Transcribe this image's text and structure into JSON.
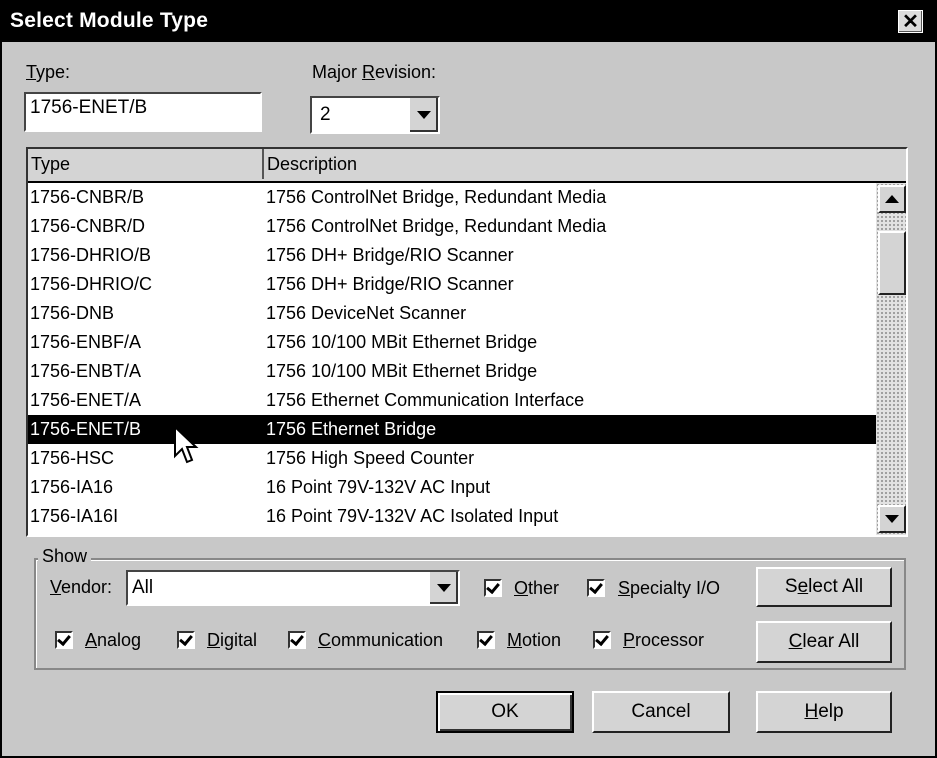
{
  "dialog": {
    "title": "Select Module Type"
  },
  "type_field": {
    "label_prefix": "",
    "label_key": "T",
    "label_rest": "ype:",
    "value": "1756-ENET/B"
  },
  "revision_field": {
    "label_prefix": "Major ",
    "label_key": "R",
    "label_rest": "evision:",
    "value": "2"
  },
  "table": {
    "columns": [
      "Type",
      "Description"
    ],
    "rows": [
      {
        "type": "1756-CNBR/B",
        "description": "1756 ControlNet Bridge, Redundant Media"
      },
      {
        "type": "1756-CNBR/D",
        "description": "1756 ControlNet Bridge, Redundant Media"
      },
      {
        "type": "1756-DHRIO/B",
        "description": "1756 DH+ Bridge/RIO Scanner"
      },
      {
        "type": "1756-DHRIO/C",
        "description": "1756 DH+ Bridge/RIO Scanner"
      },
      {
        "type": "1756-DNB",
        "description": "1756 DeviceNet Scanner"
      },
      {
        "type": "1756-ENBF/A",
        "description": "1756 10/100 MBit Ethernet Bridge"
      },
      {
        "type": "1756-ENBT/A",
        "description": "1756 10/100 MBit Ethernet Bridge"
      },
      {
        "type": "1756-ENET/A",
        "description": "1756 Ethernet Communication Interface"
      },
      {
        "type": "1756-ENET/B",
        "description": "1756 Ethernet Bridge"
      },
      {
        "type": "1756-HSC",
        "description": "1756 High Speed Counter"
      },
      {
        "type": "1756-IA16",
        "description": "16 Point 79V-132V AC Input"
      },
      {
        "type": "1756-IA16I",
        "description": "16 Point 79V-132V AC Isolated Input"
      }
    ],
    "selected_index": 8
  },
  "show": {
    "group_label": "Show",
    "vendor_label_key": "V",
    "vendor_label_rest": "endor:",
    "vendor_value": "All",
    "checkboxes": [
      {
        "key": "O",
        "rest": "ther",
        "checked": true
      },
      {
        "key": "S",
        "rest": "pecialty I/O",
        "checked": true
      },
      {
        "key": "A",
        "rest": "nalog",
        "checked": true
      },
      {
        "key": "D",
        "rest": "igital",
        "checked": true
      },
      {
        "key": "C",
        "rest": "ommunication",
        "checked": true
      },
      {
        "key": "M",
        "rest": "otion",
        "checked": true
      },
      {
        "key": "P",
        "rest": "rocessor",
        "checked": true
      }
    ],
    "select_all": {
      "pre": "S",
      "key": "e",
      "post": "lect All"
    },
    "clear_all": {
      "pre": "",
      "key": "C",
      "post": "lear All"
    }
  },
  "buttons": {
    "ok": "OK",
    "cancel": "Cancel",
    "help_key": "H",
    "help_rest": "elp"
  }
}
